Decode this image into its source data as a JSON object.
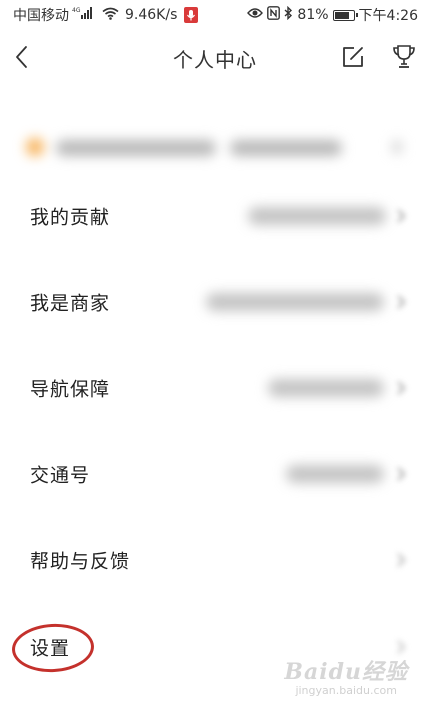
{
  "status_bar": {
    "carrier": "中国移动",
    "network_badge": "4G",
    "speed": "9.46K/s",
    "battery": "81%",
    "battery_level": 0.81,
    "time": "下午4:26",
    "icons": [
      "signal-icon",
      "wifi-icon",
      "mic-icon",
      "eye-icon",
      "nfc-icon",
      "bluetooth-icon",
      "battery-icon"
    ]
  },
  "header": {
    "title": "个人中心",
    "back_icon": "chevron-left-icon",
    "edit_icon": "edit-icon",
    "trophy_icon": "trophy-icon"
  },
  "menu": {
    "items": [
      {
        "label": "我的贡献"
      },
      {
        "label": "我是商家"
      },
      {
        "label": "导航保障"
      },
      {
        "label": "交通号"
      },
      {
        "label": "帮助与反馈"
      },
      {
        "label": "设置"
      }
    ]
  },
  "colors": {
    "annotation": "#c4312c",
    "accent_dot": "#f7b25a",
    "text": "#222222"
  },
  "watermark": {
    "logo": "Baidu经验",
    "url": "jingyan.baidu.com"
  }
}
